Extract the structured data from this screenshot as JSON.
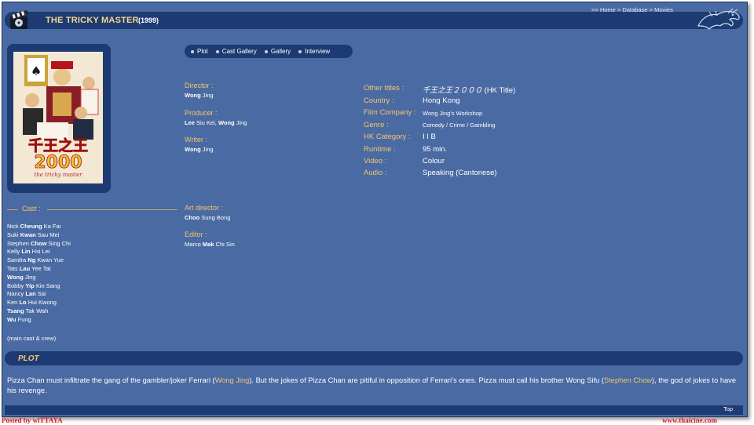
{
  "header": {
    "title": "THE TRICKY MASTER",
    "year": "(1999)",
    "breadcrumb_prefix": ">> ",
    "breadcrumb": [
      "Home",
      "Database",
      "Movies"
    ],
    "breadcrumb_sep": " > "
  },
  "tabs": [
    "Plot",
    "Cast Gallery",
    "Gallery",
    "Interview"
  ],
  "credits": {
    "director": {
      "label": "Director :",
      "names": [
        {
          "bold": "Wong",
          "rest": " Jing"
        }
      ]
    },
    "producer": {
      "label": "Producer :",
      "names": [
        {
          "bold": "Lee",
          "rest": " Siu Kei, "
        },
        {
          "bold": "Wong",
          "rest": " Jing"
        }
      ]
    },
    "writer": {
      "label": "Writer :",
      "names": [
        {
          "bold": "Wong",
          "rest": " Jing"
        }
      ]
    },
    "art_director": {
      "label": "Art director :",
      "names": [
        {
          "bold": "Choo",
          "rest": " Sung Bong"
        }
      ]
    },
    "editor": {
      "label": "Editor :",
      "names": [
        {
          "bold": "",
          "rest": "Marco "
        },
        {
          "bold": "Mak",
          "rest": " Chi Sin"
        }
      ]
    }
  },
  "info": [
    {
      "label": "Other titles :",
      "value": "千王之王２０００",
      "suffix": " (HK Title)",
      "small": false
    },
    {
      "label": "Country :",
      "value": "Hong Kong",
      "suffix": "",
      "small": false
    },
    {
      "label": "Film Company :",
      "value": "Wong Jing's Workshop",
      "suffix": "",
      "small": true
    },
    {
      "label": "Genre :",
      "value": "Comedy / Crime / Gambling",
      "suffix": "",
      "small": true
    },
    {
      "label": "HK Category :",
      "value": "I I B",
      "suffix": "",
      "small": false
    },
    {
      "label": "Runtime :",
      "value": "95 min.",
      "suffix": "",
      "small": false
    },
    {
      "label": "Video :",
      "value": "Colour",
      "suffix": "",
      "small": false
    },
    {
      "label": "Audio :",
      "value": "Speaking (Cantonese)",
      "suffix": "",
      "small": false
    }
  ],
  "cast": {
    "heading": "Cast :",
    "members": [
      {
        "pre": "Nick ",
        "bold": "Cheung",
        "post": " Ka Fai"
      },
      {
        "pre": "Suki ",
        "bold": "Kwan",
        "post": " Sau Mei"
      },
      {
        "pre": "Stephen ",
        "bold": "Chow",
        "post": " Sing Chi"
      },
      {
        "pre": "Kelly ",
        "bold": "Lin",
        "post": " Hsi Lei"
      },
      {
        "pre": "Sandra ",
        "bold": "Ng",
        "post": " Kwan Yue"
      },
      {
        "pre": "Tats ",
        "bold": "Lau",
        "post": " Yee Tat"
      },
      {
        "pre": "",
        "bold": "Wong",
        "post": " Jing"
      },
      {
        "pre": "Bobby ",
        "bold": "Yip",
        "post": " Kin Sang"
      },
      {
        "pre": "Nancy ",
        "bold": "Lan",
        "post": " Sai"
      },
      {
        "pre": "Ken ",
        "bold": "Lo",
        "post": " Hui Kwong"
      },
      {
        "pre": "",
        "bold": "Tsang",
        "post": " Tak Wah"
      },
      {
        "pre": "",
        "bold": "Wu",
        "post": " Fung"
      }
    ],
    "note": "(main cast & crew)"
  },
  "poster": {
    "title_text": "千王之王",
    "number_text": "2000",
    "subtitle": "the tricky master"
  },
  "plot": {
    "heading": "PLOT",
    "text_1": "Pizza Chan must infiltrate the gang of the gambler/joker Ferrari (",
    "link_1": "Wong Jing",
    "text_2": "). But the jokes of Pizza Chan are pitiful in opposition of Ferrari's ones. Pizza must call his brother Wong Sifu (",
    "link_2": "Stephen Chow",
    "text_3": "), the god of jokes to have his revenge."
  },
  "footer": {
    "top_link": "Top",
    "posted_by": "Posted by wiTTAYA",
    "site": "www.thaicine.com"
  },
  "colors": {
    "background": "#4a6aa3",
    "bar": "#1d3a72",
    "label": "#f7c56a",
    "title": "#f7d68b",
    "watermark": "#d8162b"
  }
}
